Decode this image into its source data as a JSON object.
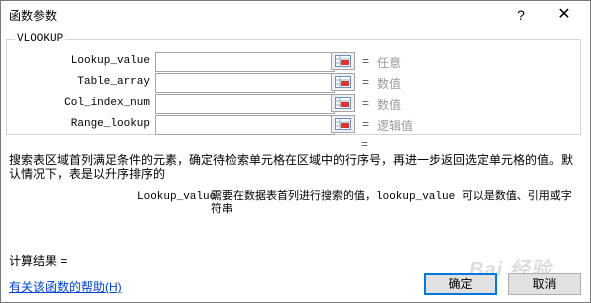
{
  "window": {
    "title": "函数参数",
    "help_symbol": "?",
    "close_symbol": "✕"
  },
  "function_group": {
    "name": "VLOOKUP",
    "args": [
      {
        "label": "Lookup_value",
        "value": "",
        "eq": "=",
        "type": "任意"
      },
      {
        "label": "Table_array",
        "value": "",
        "eq": "=",
        "type": "数值"
      },
      {
        "label": "Col_index_num",
        "value": "",
        "eq": "=",
        "type": "数值"
      },
      {
        "label": "Range_lookup",
        "value": "",
        "eq": "=",
        "type": "逻辑值"
      }
    ]
  },
  "result_eq": "=",
  "description": {
    "main": "搜索表区域首列满足条件的元素，确定待检索单元格在区域中的行序号，再进一步返回选定单元格的值。默认情况下，表是以升序排序的",
    "arg_name": "Lookup_value",
    "arg_text": "需要在数据表首列进行搜索的值，lookup_value 可以是数值、引用或字符串"
  },
  "calc_result_label": "计算结果 =",
  "help_link": "有关该函数的帮助(H)",
  "buttons": {
    "ok": "确定",
    "cancel": "取消"
  },
  "watermark": "Bai 经验"
}
